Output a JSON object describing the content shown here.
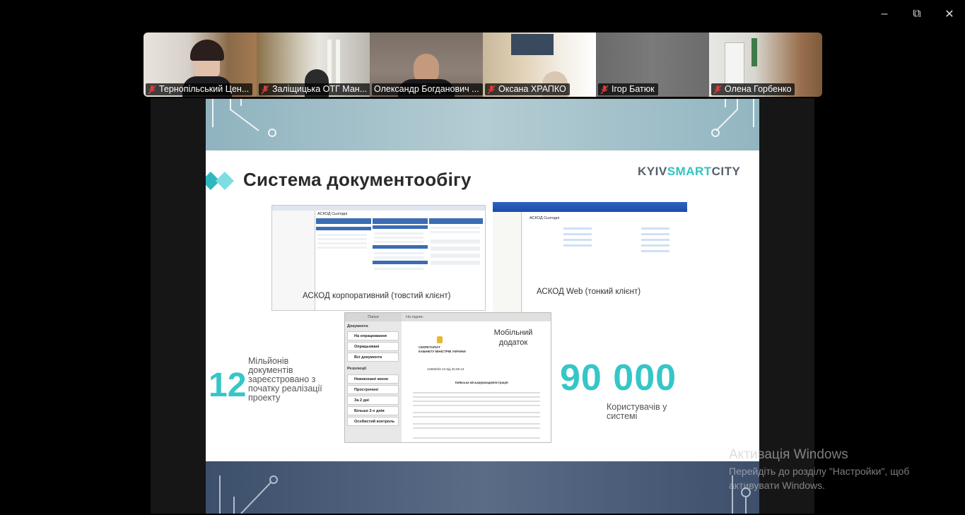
{
  "window_controls": {
    "minimize": "–",
    "restore": "⧉",
    "close": "✕"
  },
  "participants": [
    {
      "name": "Тернопільський Цен...",
      "muted": true,
      "active": false
    },
    {
      "name": "Заліщицька ОТГ Ман...",
      "muted": true,
      "active": false
    },
    {
      "name": "Олександр Богданович ...",
      "muted": false,
      "active": true
    },
    {
      "name": "Оксана ХРАПКО",
      "muted": true,
      "active": false
    },
    {
      "name": "Ігор Батюк",
      "muted": true,
      "active": false
    },
    {
      "name": "Олена Горбенко",
      "muted": true,
      "active": false
    }
  ],
  "slide": {
    "title": "Система документообігу",
    "logo_part1": "KYIV",
    "logo_part2": "SMART",
    "logo_part3": "CITY",
    "screen1": {
      "app_title": "АСКОД Сьогодні",
      "caption": "АСКОД корпоративний (товстий клієнт)"
    },
    "screen2": {
      "app_title": "АСКОД Сьогодні",
      "caption": "АСКОД Web (тонкий клієнт)"
    },
    "mobile": {
      "caption_line1": "Мобільний",
      "caption_line2": "додаток",
      "left_title": "Папки",
      "right_title": "На підпис",
      "section_docs": "Документи",
      "items_docs": [
        "На опрацювання",
        "Опрацьовані",
        "Всі документи"
      ],
      "section_resolutions": "Резолюції",
      "items_resolutions": [
        "Невиконані мною",
        "Прострочені",
        "За 2 дні",
        "Більше 2-х днів",
        "Особистий контроль"
      ],
      "doc_header1": "СЕКРЕТАРІАТ",
      "doc_header2": "КАБІНЕТУ МІНІСТРІВ УКРАЇНИ",
      "doc_number": "11960/0/2-13 від 20.09.13",
      "doc_to": "Київська міськдержадміністрація"
    },
    "stat1": {
      "value": "12",
      "line1": "Мільйонів",
      "line2": "документів",
      "line3": "зареєстровано з",
      "line4": "початку реалізації",
      "line5": "проекту"
    },
    "stat2": {
      "value": "90 000",
      "line1": "Користувачів у",
      "line2": "системі"
    }
  },
  "watermark": {
    "title": "Активація Windows",
    "line1": "Перейдіть до розділу \"Настройки\", щоб",
    "line2": "активувати Windows."
  }
}
